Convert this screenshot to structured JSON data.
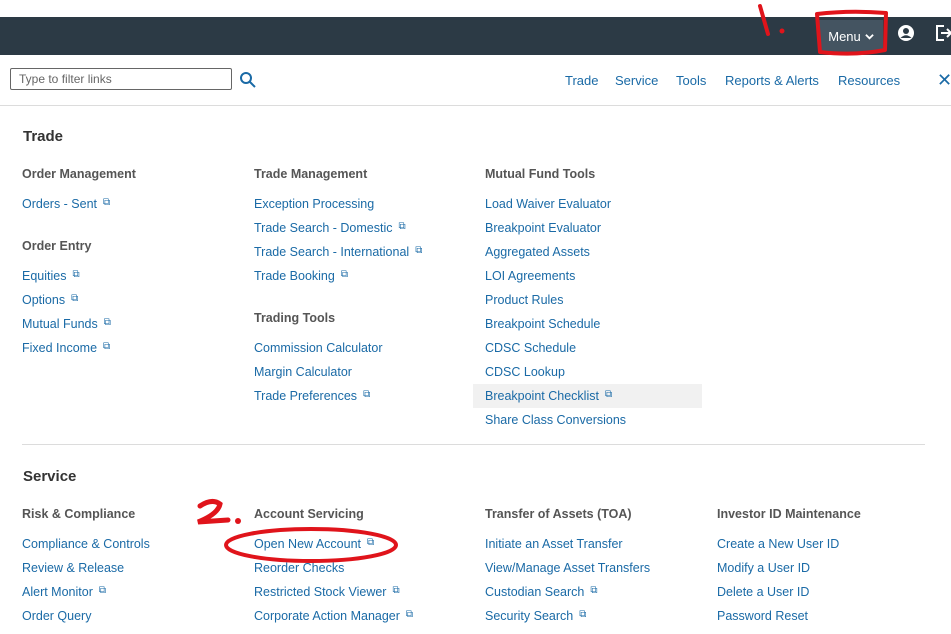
{
  "header": {
    "menu_label": "Menu",
    "menu_chevron": "⌄"
  },
  "icons": {
    "user": "user-circle-icon",
    "logout": "logout-icon",
    "search": "search-icon",
    "external": "external-link-icon",
    "close": "close-icon"
  },
  "filter": {
    "placeholder": "Type to filter links"
  },
  "nav": {
    "links": [
      "Trade",
      "Service",
      "Tools",
      "Reports & Alerts",
      "Resources"
    ],
    "close_glyph": "✕"
  },
  "ext_glyph": "⧉",
  "trade": {
    "title": "Trade",
    "order_management": {
      "title": "Order Management",
      "links": [
        "Orders - Sent"
      ]
    },
    "order_entry": {
      "title": "Order Entry",
      "links": [
        "Equities",
        "Options",
        "Mutual Funds",
        "Fixed Income"
      ]
    },
    "trade_management": {
      "title": "Trade Management",
      "links": [
        "Exception Processing",
        "Trade Search - Domestic",
        "Trade Search - International",
        "Trade Booking"
      ]
    },
    "trading_tools": {
      "title": "Trading Tools",
      "links": [
        "Commission Calculator",
        "Margin Calculator",
        "Trade Preferences"
      ]
    },
    "mutual_fund_tools": {
      "title": "Mutual Fund Tools",
      "links": [
        "Load Waiver Evaluator",
        "Breakpoint Evaluator",
        "Aggregated Assets",
        "LOI Agreements",
        "Product Rules",
        "Breakpoint Schedule",
        "CDSC Schedule",
        "CDSC Lookup",
        "Breakpoint Checklist",
        "Share Class Conversions"
      ]
    }
  },
  "service": {
    "title": "Service",
    "risk_compliance": {
      "title": "Risk & Compliance",
      "links": [
        "Compliance & Controls",
        "Review & Release",
        "Alert Monitor",
        "Order Query"
      ]
    },
    "account_servicing": {
      "title": "Account Servicing",
      "links": [
        "Open New Account",
        "Reorder Checks",
        "Restricted Stock Viewer",
        "Corporate Action Manager"
      ]
    },
    "transfer_assets": {
      "title": "Transfer of Assets (TOA)",
      "links": [
        "Initiate an Asset Transfer",
        "View/Manage Asset Transfers",
        "Custodian Search",
        "Security Search"
      ]
    },
    "investor_id": {
      "title": "Investor ID Maintenance",
      "links": [
        "Create a New User ID",
        "Modify a User ID",
        "Delete a User ID",
        "Password Reset"
      ]
    }
  },
  "annotations": {
    "one": "1.",
    "two": "2."
  },
  "colors": {
    "topbar": "#2c3a45",
    "link": "#1a6aa6",
    "annotation": "#e0141b"
  }
}
